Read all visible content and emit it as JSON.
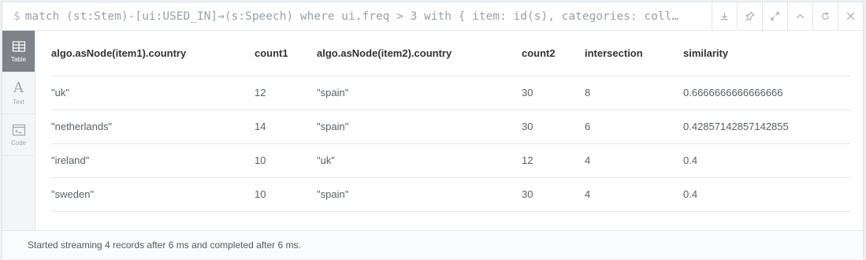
{
  "query": {
    "prompt": "$",
    "text": "match (st:Stem)-[ui:USED_IN]→(s:Speech) where ui.freq > 3 with { item: id(s), categories: coll…"
  },
  "actions": [
    {
      "name": "download-icon"
    },
    {
      "name": "pin-icon"
    },
    {
      "name": "expand-icon"
    },
    {
      "name": "collapse-up-icon"
    },
    {
      "name": "rerun-icon"
    },
    {
      "name": "close-icon"
    }
  ],
  "views": [
    {
      "label": "Table",
      "icon": "table-icon",
      "active": true
    },
    {
      "label": "Text",
      "icon": "text-icon",
      "active": false
    },
    {
      "label": "Code",
      "icon": "code-icon",
      "active": false
    }
  ],
  "table": {
    "columns": [
      "algo.asNode(item1).country",
      "count1",
      "algo.asNode(item2).country",
      "count2",
      "intersection",
      "similarity"
    ],
    "rows": [
      [
        "\"uk\"",
        "12",
        "\"spain\"",
        "30",
        "8",
        "0.6666666666666666"
      ],
      [
        "\"netherlands\"",
        "14",
        "\"spain\"",
        "30",
        "6",
        "0.42857142857142855"
      ],
      [
        "\"ireland\"",
        "10",
        "\"uk\"",
        "12",
        "4",
        "0.4"
      ],
      [
        "\"sweden\"",
        "10",
        "\"spain\"",
        "30",
        "4",
        "0.4"
      ]
    ]
  },
  "status": "Started streaming 4 records after 6 ms and completed after 6 ms."
}
